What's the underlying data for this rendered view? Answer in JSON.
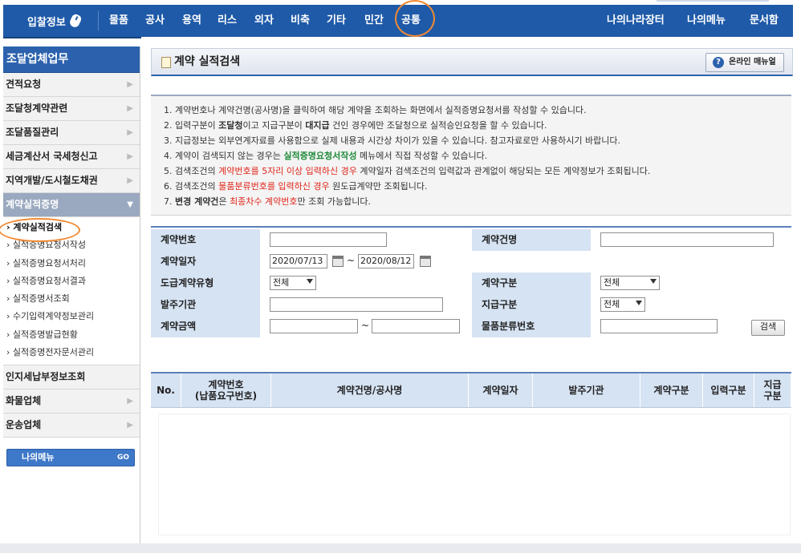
{
  "topbar": {
    "logo_label": "입찰정보",
    "nav": [
      "물품",
      "공사",
      "용역",
      "리스",
      "외자",
      "비축",
      "기타",
      "민간",
      "공통"
    ],
    "right_nav": [
      "나의나라장터",
      "나의메뉴",
      "문서함"
    ]
  },
  "sidebar": {
    "title": "조달업체업무",
    "items_top": [
      "견적요청",
      "조달청계약관련",
      "조달품질관리",
      "세금계산서 국세청신고",
      "지역개발/도시철도채권",
      "계약실적증명"
    ],
    "sub_items": [
      "계약실적검색",
      "실적증명요청서작성",
      "실적증명요청서처리",
      "실적증명요청서결과",
      "실적증명서조회",
      "수기입력계약정보관리",
      "실적증명발급현황",
      "실적증명전자문서관리"
    ],
    "items_bottom": [
      "인지세납부정보조회",
      "화물업체",
      "운송업체"
    ],
    "my_menu": "나의메뉴",
    "my_menu_go": "GO"
  },
  "page": {
    "title": "계약 실적검색",
    "manual_button": "온라인 매뉴얼"
  },
  "notice": {
    "l1": "1. 계약번호나 계약건명(공사명)을 클릭하여 해당 계약을 조회하는 화면에서 실적증명요청서를 작성할 수 있습니다.",
    "l2a": "2. 입력구분이 ",
    "l2b": "조달청",
    "l2c": "이고 지급구분이 ",
    "l2d": "대지급",
    "l2e": " 건인 경우에만 조달청으로 실적승인요청을 할 수 있습니다.",
    "l3": "3. 지급정보는 외부연계자료를 사용함으로 실제 내용과 시간상 차이가 있을 수 있습니다. 참고자료로만 사용하시기 바랍니다.",
    "l4a": "4. 계약이 검색되지 않는 경우는 ",
    "l4b": "실적증명요청서작성",
    "l4c": " 메뉴에서 직접 작성할 수 있습니다.",
    "l5a": "5. 검색조건의 ",
    "l5b": "계약번호를 5자리 이상 입력하신 경우",
    "l5c": " 계약일자 검색조건의 입력값과 관계없이 해당되는 모든 계약정보가 조회됩니다.",
    "l6a": "6. 검색조건의 ",
    "l6b": "물품분류번호를 입력하신 경우",
    "l6c": " 원도급계약만 조회됩니다.",
    "l7a": "7. ",
    "l7b": "변경 계약건",
    "l7c": "은 ",
    "l7d": "최종차수 계약번호",
    "l7e": "만 조회 가능합니다."
  },
  "search": {
    "contract_no_label": "계약번호",
    "contract_name_label": "계약건명",
    "contract_date_label": "계약일자",
    "date_from": "2020/07/13",
    "date_sep": "~",
    "date_to": "2020/08/12",
    "subcontract_type_label": "도급계약유형",
    "subcontract_type_value": "전체",
    "contract_kind_label": "계약구분",
    "contract_kind_value": "전체",
    "ordering_org_label": "발주기관",
    "payment_kind_label": "지급구분",
    "payment_kind_value": "전체",
    "amount_label": "계약금액",
    "amount_sep": "~",
    "item_class_label": "물품분류번호",
    "search_button": "검색"
  },
  "results": {
    "headers": [
      "No.",
      "계약번호\n(납품요구번호)",
      "계약건명/공사명",
      "계약일자",
      "발주기관",
      "계약구분",
      "입력구분",
      "지급\n구분"
    ]
  }
}
